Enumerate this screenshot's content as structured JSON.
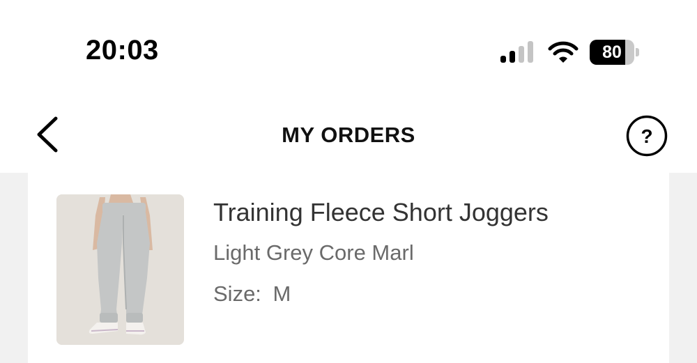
{
  "status_bar": {
    "time": "20:03",
    "battery_level": "80",
    "signal_bars_active": 2,
    "signal_bars_total": 4,
    "icons": [
      "signal-icon",
      "wifi-icon",
      "battery-icon"
    ]
  },
  "header": {
    "title": "MY ORDERS",
    "back_icon": "chevron-left-icon",
    "help_icon": "question-circle-icon"
  },
  "order_item": {
    "name": "Training Fleece Short Joggers",
    "color": "Light Grey Core Marl",
    "size_label": "Size:",
    "size_value": "M"
  },
  "colors": {
    "background": "#f1f1f1",
    "card": "#ffffff",
    "title_text": "#111111",
    "product_name": "#333333",
    "secondary_text": "#6a6a6a"
  }
}
